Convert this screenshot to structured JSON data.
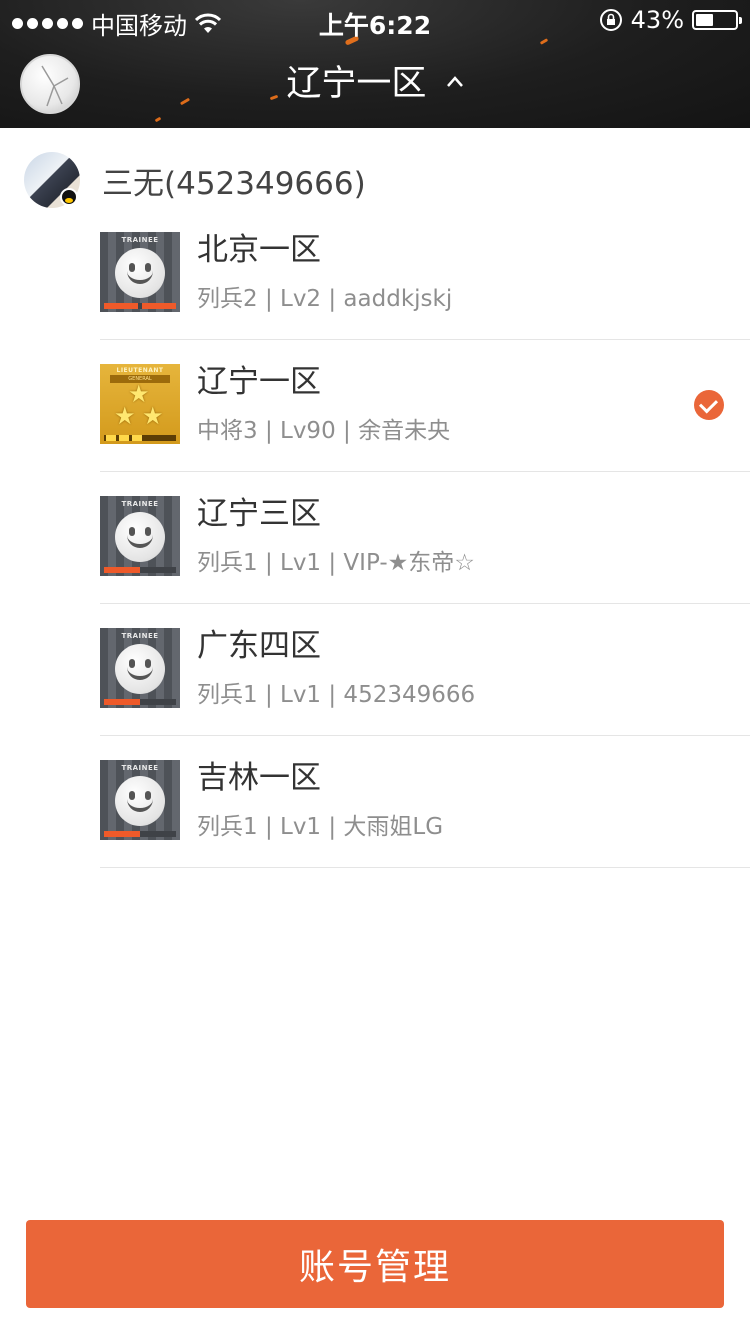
{
  "status_bar": {
    "carrier": "中国移动",
    "time": "上午6:22",
    "battery": "43%",
    "battery_level": 0.43,
    "icons": [
      "signal-dots-icon",
      "wifi-icon",
      "rotation-lock-icon",
      "battery-icon"
    ]
  },
  "nav": {
    "title": "辽宁一区",
    "caret_icon": "chevron-up-icon"
  },
  "account": {
    "name": "三无(452349666)",
    "badge_icon": "qq-penguin-icon"
  },
  "servers": [
    {
      "name": "北京一区",
      "detail": "列兵2 | Lv2 | aaddkjskj",
      "rank_tag": "TRAINEE",
      "rank_type": "trainee",
      "progress": 1.0,
      "selected": false
    },
    {
      "name": "辽宁一区",
      "detail": "中将3 | Lv90 | 余音未央",
      "rank_tag": "LIEUTENANT",
      "rank_tag2": "GENERAL",
      "rank_type": "general",
      "progress": 0.6,
      "selected": true
    },
    {
      "name": "辽宁三区",
      "detail": "列兵1 | Lv1 | VIP-★东帝☆",
      "rank_tag": "TRAINEE",
      "rank_type": "trainee",
      "progress": 0.5,
      "selected": false
    },
    {
      "name": "广东四区",
      "detail": "列兵1 | Lv1 | 452349666",
      "rank_tag": "TRAINEE",
      "rank_type": "trainee",
      "progress": 0.5,
      "selected": false
    },
    {
      "name": "吉林一区",
      "detail": "列兵1 | Lv1 | 大雨姐LG",
      "rank_tag": "TRAINEE",
      "rank_type": "trainee",
      "progress": 0.5,
      "selected": false
    }
  ],
  "selected_icon": "checkmark-circle-icon",
  "footer": {
    "button_label": "账号管理"
  },
  "colors": {
    "accent": "#ea6639",
    "header_bg": "#1e1e1e",
    "text_primary": "#333333",
    "text_secondary": "#8e8e8e"
  }
}
